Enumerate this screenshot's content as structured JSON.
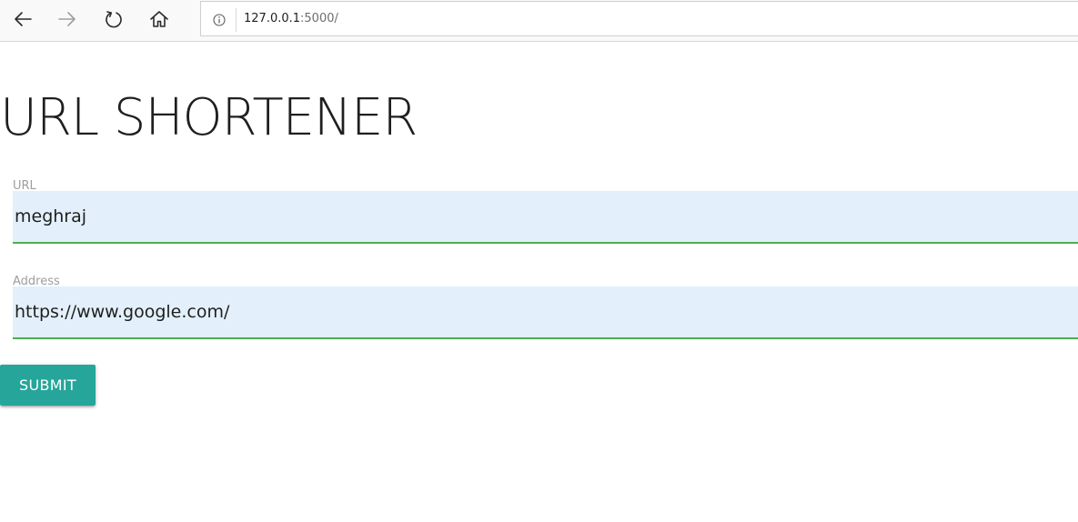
{
  "browser": {
    "url_host": "127.0.0.1",
    "url_rest": ":5000/",
    "icons": [
      "back-arrow-icon",
      "forward-arrow-icon",
      "reload-icon",
      "home-icon",
      "info-icon"
    ]
  },
  "page": {
    "title": "URL SHORTENER",
    "form": {
      "url_label": "URL",
      "url_value": "meghraj",
      "address_label": "Address",
      "address_value": "https://www.google.com/",
      "submit_label": "SUBMIT"
    }
  },
  "colors": {
    "accent": "#26a69a",
    "field_bg": "#e3f0fb",
    "field_underline": "#4caf50",
    "label": "#9e9e9e",
    "text": "#1f1f1f"
  }
}
